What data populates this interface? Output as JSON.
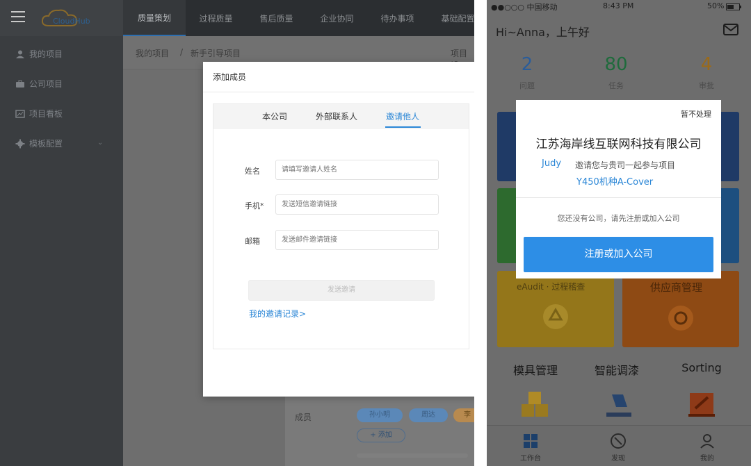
{
  "web": {
    "logo_text": "CloudHub",
    "menu": [
      {
        "label": "我的项目"
      },
      {
        "label": "公司项目"
      },
      {
        "label": "项目看板"
      },
      {
        "label": "模板配置"
      }
    ],
    "tabs": [
      {
        "label": "质量策划",
        "active": true
      },
      {
        "label": "过程质量"
      },
      {
        "label": "售后质量"
      },
      {
        "label": "企业协同"
      },
      {
        "label": "待办事项"
      },
      {
        "label": "基础配置"
      }
    ],
    "breadcrumb": [
      "我的项目",
      "/",
      "新手引导项目"
    ],
    "right_crumb": "项目设",
    "members_label": "成员",
    "member_pills": [
      "孙小明",
      "周达",
      "李"
    ],
    "add_member": "+ 添加",
    "modal": {
      "title": "添加成员",
      "tabs": [
        "本公司",
        "外部联系人",
        "邀请他人"
      ],
      "fields": [
        {
          "label": "姓名",
          "placeholder": "请填写邀请人姓名"
        },
        {
          "label": "手机*",
          "placeholder": "发送短信邀请链接"
        },
        {
          "label": "邮箱",
          "placeholder": "发送邮件邀请链接"
        }
      ],
      "send_button": "发送邀请",
      "history_link": "我的邀请记录>"
    }
  },
  "phone": {
    "status_left": "●●○○○ 中国移动",
    "status_time": "8:43 PM",
    "status_battery": "50%",
    "greeting": "Hi~Anna，上午好",
    "stats": [
      {
        "num": "2",
        "label": "问题",
        "color": "#2b5d9a"
      },
      {
        "num": "80",
        "label": "任务",
        "color": "#1f6b3c"
      },
      {
        "num": "4",
        "label": "审批",
        "color": "#9a6a1a"
      }
    ],
    "tiles": {
      "eaudit": "eAudit · 过程稽查",
      "supplier": "供应商管理"
    },
    "sections": [
      "模具管理",
      "智能调漆",
      "Sorting"
    ],
    "tabbar": [
      "工作台",
      "发现",
      "我的"
    ],
    "invite": {
      "ignore": "暂不处理",
      "company": "江苏海岸线互联网科技有限公司",
      "inviter": "Judy",
      "text": "邀请您与贵司一起参与项目",
      "project": "Y450机种A-Cover",
      "hint": "您还没有公司，请先注册或加入公司",
      "button": "注册或加入公司"
    }
  }
}
